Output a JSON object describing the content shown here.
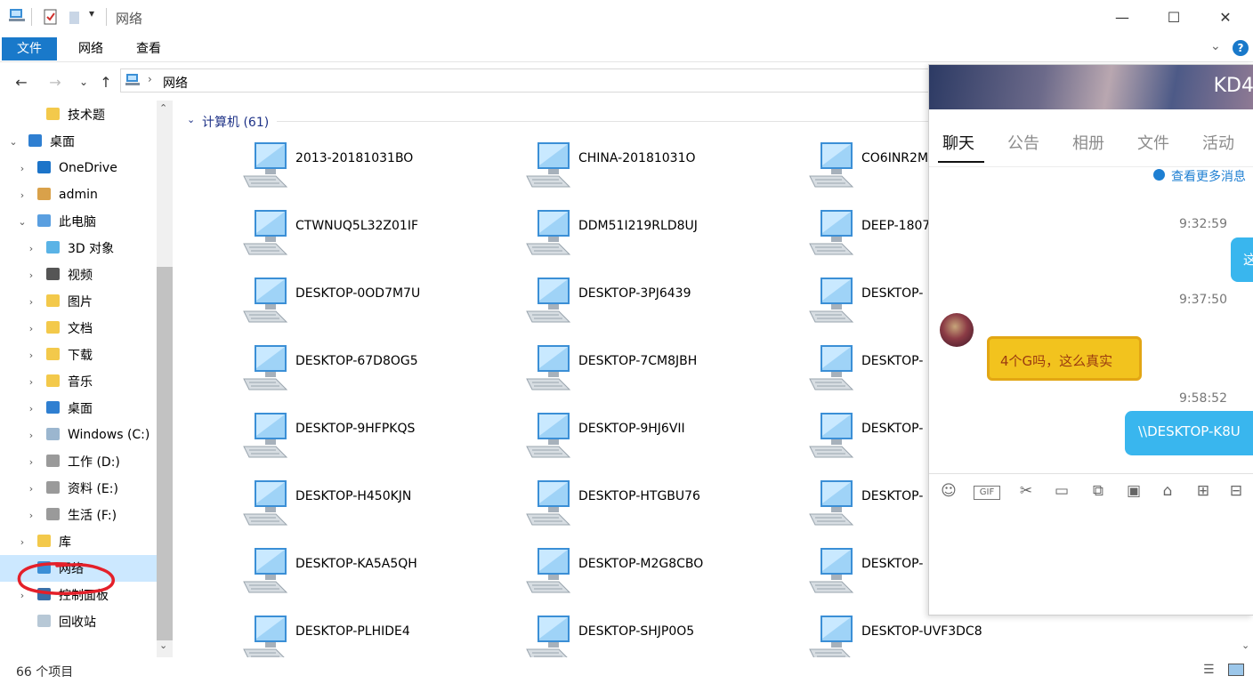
{
  "window": {
    "title": "网络",
    "minimize_glyph": "—",
    "maximize_glyph": "☐",
    "close_glyph": "✕"
  },
  "ribbon": {
    "tabs": [
      {
        "label": "文件"
      },
      {
        "label": "网络"
      },
      {
        "label": "查看"
      }
    ],
    "help_glyph": "?"
  },
  "address": {
    "path": "网络"
  },
  "nav_pane": {
    "items": [
      {
        "label": "技术题",
        "icon": "folder-icon",
        "level": 2,
        "chevron": ""
      },
      {
        "label": "桌面",
        "icon": "desktop-icon",
        "level": 0,
        "chevron": "⌄"
      },
      {
        "label": "OneDrive",
        "icon": "cloud-icon",
        "level": 1,
        "chevron": "›"
      },
      {
        "label": "admin",
        "icon": "user-icon",
        "level": 1,
        "chevron": "›"
      },
      {
        "label": "此电脑",
        "icon": "pc-icon",
        "level": 1,
        "chevron": "⌄"
      },
      {
        "label": "3D 对象",
        "icon": "cube-icon",
        "level": 2,
        "chevron": "›"
      },
      {
        "label": "视频",
        "icon": "video-icon",
        "level": 2,
        "chevron": "›"
      },
      {
        "label": "图片",
        "icon": "pictures-icon",
        "level": 2,
        "chevron": "›"
      },
      {
        "label": "文档",
        "icon": "documents-icon",
        "level": 2,
        "chevron": "›"
      },
      {
        "label": "下载",
        "icon": "download-icon",
        "level": 2,
        "chevron": "›"
      },
      {
        "label": "音乐",
        "icon": "music-icon",
        "level": 2,
        "chevron": "›"
      },
      {
        "label": "桌面",
        "icon": "desktop-folder-icon",
        "level": 2,
        "chevron": "›"
      },
      {
        "label": "Windows (C:)",
        "icon": "windows-drive-icon",
        "level": 2,
        "chevron": "›"
      },
      {
        "label": "工作 (D:)",
        "icon": "drive-icon",
        "level": 2,
        "chevron": "›"
      },
      {
        "label": "资料 (E:)",
        "icon": "drive-icon",
        "level": 2,
        "chevron": "›"
      },
      {
        "label": "生活 (F:)",
        "icon": "drive-icon",
        "level": 2,
        "chevron": "›"
      },
      {
        "label": "库",
        "icon": "library-icon",
        "level": 1,
        "chevron": "›"
      },
      {
        "label": "网络",
        "icon": "network-icon",
        "level": 1,
        "chevron": "",
        "selected": true
      },
      {
        "label": "控制面板",
        "icon": "control-panel-icon",
        "level": 1,
        "chevron": "›"
      },
      {
        "label": "回收站",
        "icon": "recycle-bin-icon",
        "level": 1,
        "chevron": ""
      }
    ]
  },
  "content": {
    "group_header": "计算机 (61)",
    "computers": [
      "2013-20181031BO",
      "CHINA-20181031O",
      "CO6INR2M",
      "CTWNUQ5L32Z01IF",
      "DDM51I219RLD8UJ",
      "DEEP-1807",
      "DESKTOP-0OD7M7U",
      "DESKTOP-3PJ6439",
      "DESKTOP-",
      "DESKTOP-67D8OG5",
      "DESKTOP-7CM8JBH",
      "DESKTOP-",
      "DESKTOP-9HFPKQS",
      "DESKTOP-9HJ6VII",
      "DESKTOP-",
      "DESKTOP-H450KJN",
      "DESKTOP-HTGBU76",
      "DESKTOP-",
      "DESKTOP-KA5A5QH",
      "DESKTOP-M2G8CBO",
      "DESKTOP-",
      "DESKTOP-PLHIDE4",
      "DESKTOP-SHJP0O5",
      "DESKTOP-UVF3DC8"
    ]
  },
  "status": {
    "item_count": "66 个项目"
  },
  "chat": {
    "title": "KD4",
    "tabs": [
      "聊天",
      "公告",
      "相册",
      "文件",
      "活动"
    ],
    "more_messages": "查看更多消息",
    "messages": [
      {
        "time": "9:32:59",
        "text": "这"
      },
      {
        "time": "9:37:50",
        "text": "4个G吗，这么真实"
      },
      {
        "time": "9:58:52",
        "text": "\\\\DESKTOP-K8U"
      }
    ],
    "toolbar_icons": [
      "emoji-icon",
      "gif-icon",
      "scissors-icon",
      "folder-icon",
      "puzzle-icon",
      "image-icon",
      "shop-icon",
      "gift-icon",
      "archive-icon"
    ]
  },
  "colors": {
    "accent": "#1979ca",
    "selection": "#cce8ff",
    "chat_bubble_blue": "#39b6ee",
    "chat_bubble_yellow": "#f2c31e",
    "group_header": "#1e3287"
  }
}
